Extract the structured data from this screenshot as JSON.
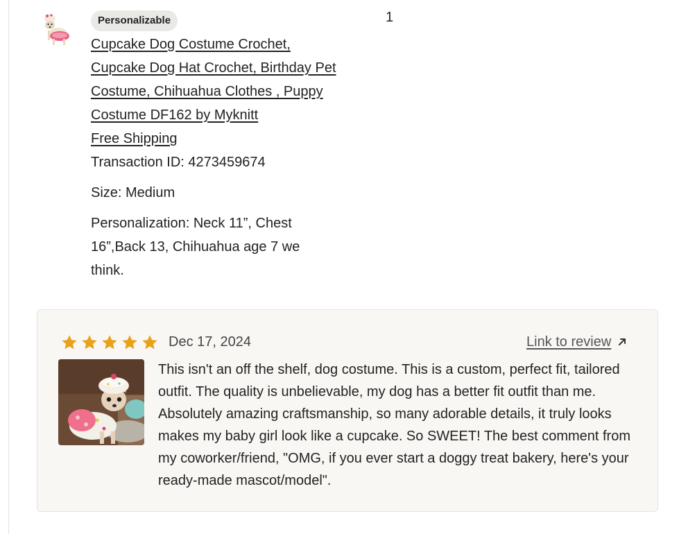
{
  "order": {
    "badge": "Personalizable",
    "title": "Cupcake Dog Costume Crochet, Cupcake Dog Hat Crochet, Birthday Pet Costume, Chihuahua Clothes , Puppy Costume DF162 by Myknitt",
    "shipping_label": "Free Shipping",
    "transaction_id": "Transaction ID: 4273459674",
    "size": "Size: Medium",
    "personalization": "Personalization: Neck 11”, Chest 16”,Back 13, Chihuahua age 7 we think.",
    "quantity": "1",
    "thumbnail_icon": "dog-cupcake-costume-thumbnail"
  },
  "review": {
    "rating": 5,
    "rating_max": 5,
    "star_color": "#e8a11a",
    "date": "Dec 17, 2024",
    "link_label": "Link to review",
    "link_icon": "arrow-up-right-icon",
    "photo_icon": "review-dog-photo",
    "text": "This isn't an off the shelf, dog costume. This is a custom, perfect fit, tailored outfit. The quality is unbelievable, my dog has a better fit outfit than me. Absolutely amazing craftsmanship, so many adorable details, it truly looks makes my baby girl look like a cupcake. So SWEET! The best comment from my coworker/friend, \"OMG, if you ever start a doggy treat bakery, here's your ready-made mascot/model\"."
  }
}
